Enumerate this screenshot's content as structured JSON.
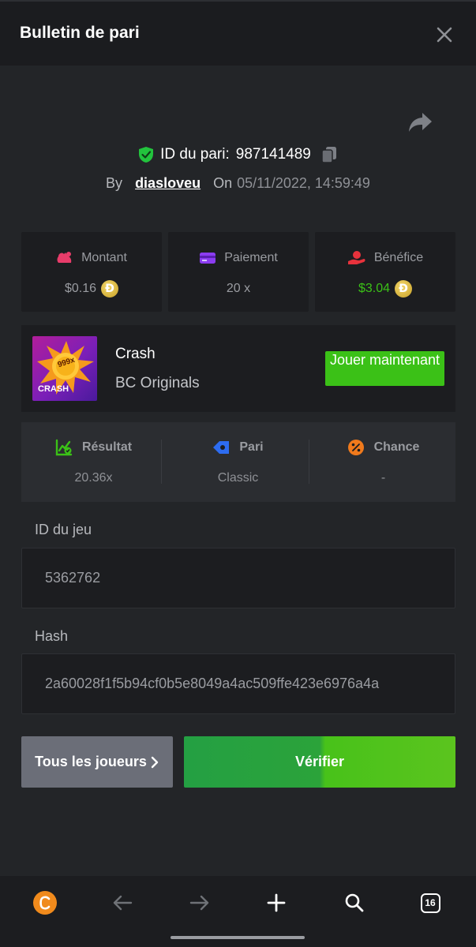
{
  "header": {
    "title": "Bulletin de pari"
  },
  "bet": {
    "id_label": "ID du pari:",
    "id_value": "987141489",
    "by_label": "By",
    "username": "diasloveu",
    "on_label": "On",
    "datetime": "05/11/2022, 14:59:49"
  },
  "stats": [
    {
      "label": "Montant",
      "value": "$0.16",
      "icon": "money-bag-icon",
      "coin": "Đ"
    },
    {
      "label": "Paiement",
      "value": "20 x",
      "icon": "card-icon"
    },
    {
      "label": "Bénéfice",
      "value": "$3.04",
      "icon": "profit-hand-icon",
      "coin": "Đ"
    }
  ],
  "game": {
    "name": "Crash",
    "provider": "BC Originals",
    "thumb_badge": "999x",
    "thumb_label": "CRASH",
    "play_label": "Jouer maintenant"
  },
  "result": [
    {
      "label": "Résultat",
      "value": "20.36x",
      "icon": "chart-check-icon"
    },
    {
      "label": "Pari",
      "value": "Classic",
      "icon": "ticket-icon"
    },
    {
      "label": "Chance",
      "value": "-",
      "icon": "percent-icon"
    }
  ],
  "fields": {
    "game_id_label": "ID du jeu",
    "game_id_value": "5362762",
    "hash_label": "Hash",
    "hash_value": "2a60028f1f5b94cf0b5e8049a4ac509ffe423e6976a4a"
  },
  "buttons": {
    "all_players": "Tous les joueurs",
    "verify": "Vérifier"
  },
  "nav": {
    "tabs_count": "16"
  },
  "colors": {
    "accent_green": "#3bc117",
    "shield_green": "#22c33d",
    "background": "#232528",
    "card": "#1c1d20"
  }
}
